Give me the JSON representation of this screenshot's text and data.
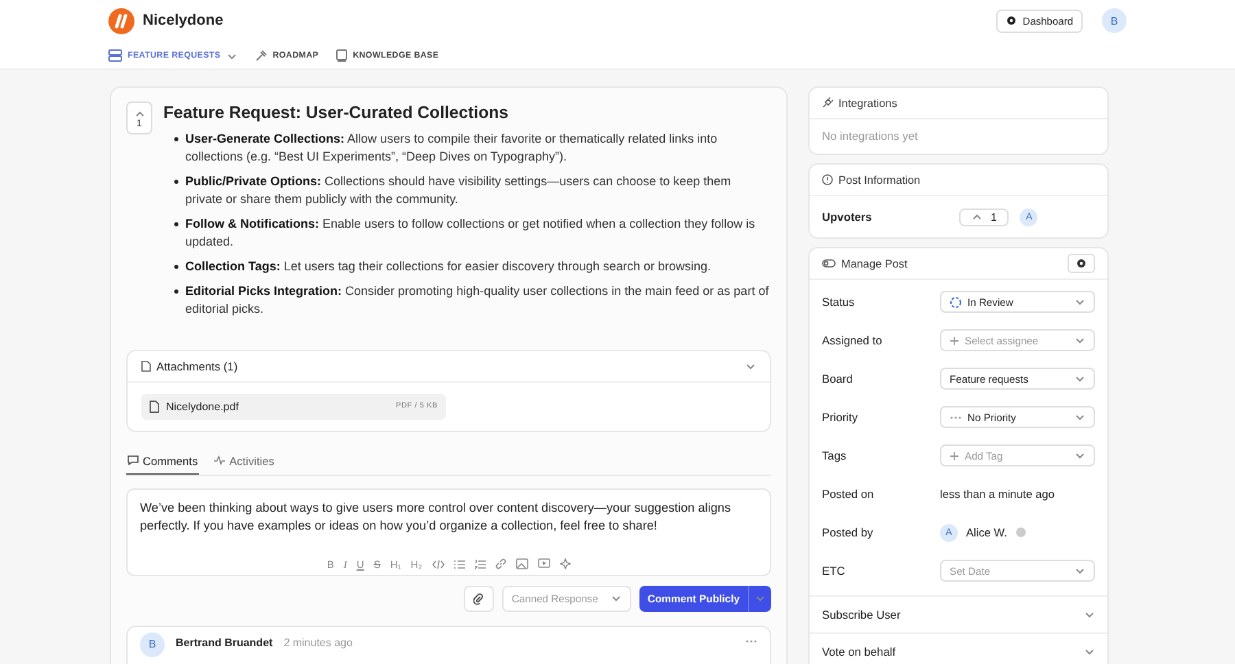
{
  "app": {
    "name": "Nicelydone",
    "dashboard_button": "Dashboard",
    "user_initial": "B"
  },
  "nav": [
    {
      "label": "FEATURE REQUESTS",
      "selected": true,
      "kind": "boards"
    },
    {
      "label": "ROADMAP",
      "selected": false,
      "kind": "roadmap"
    },
    {
      "label": "KNOWLEDGE BASE",
      "selected": false,
      "kind": "book"
    }
  ],
  "post": {
    "votes": "1",
    "title": "Feature Request: User-Curated Collections",
    "bullets": [
      "**User-Generate Collections:** Allow users to compile their favorite or thematically related links into collections (e.g. “Best UI Experiments”, “Deep Dives on Typography”).",
      "**Public/Private Options:** Collections should have visibility settings—users can choose to keep them private or share them publicly with the community.",
      "**Follow & Notifications:** Enable users to follow collections or get notified when a collection they follow is updated.",
      "**Collection Tags:** Let users tag their collections for easier discovery through search or browsing.",
      "**Editorial Picks Integration:** Consider promoting high-quality user collections in the main feed or as part of editorial picks."
    ]
  },
  "attachments": {
    "title": "Attachments (1)",
    "files": [
      {
        "name": "Nicelydone.pdf",
        "meta": "PDF / 5 KB"
      }
    ]
  },
  "tabs": [
    {
      "label": "Comments",
      "selected": true,
      "kind": "comments"
    },
    {
      "label": "Activities",
      "selected": false,
      "kind": "activity"
    }
  ],
  "editor": {
    "value": "We’ve been thinking about ways to give users more control over content discovery—your suggestion aligns perfectly. If you have examples or ideas on how you’d organize a collection, feel free to share!",
    "format_buttons": [
      "B",
      "I",
      "U",
      "S",
      "H₁",
      "H₂"
    ],
    "canned_response": {
      "placeholder": "Canned Response"
    },
    "submit": "Comment Publicly"
  },
  "comments": [
    {
      "initial": "B",
      "author": "Bertrand Bruandet",
      "time": "2 minutes ago"
    }
  ],
  "integrations": {
    "title": "Integrations",
    "empty": "No integrations yet"
  },
  "post_information": {
    "title": "Post Information",
    "upvoters_label": "Upvoters",
    "upvote_count": "1",
    "upvoter_initials": [
      "A"
    ]
  },
  "manage_post": {
    "title": "Manage Post",
    "fields": [
      {
        "label": "Status",
        "kind": "status",
        "value": "In Review"
      },
      {
        "label": "Assigned to",
        "kind": "add",
        "placeholder": "Select assignee"
      },
      {
        "label": "Board",
        "kind": "select",
        "value": "Feature requests"
      },
      {
        "label": "Priority",
        "kind": "priority",
        "value": "No Priority"
      },
      {
        "label": "Tags",
        "kind": "add",
        "placeholder": "Add Tag"
      },
      {
        "label": "Posted on",
        "kind": "text",
        "value": "less than a minute ago"
      },
      {
        "label": "Posted by",
        "kind": "user",
        "initial": "A",
        "value": "Alice W."
      },
      {
        "label": "ETC",
        "kind": "select",
        "placeholder": "Set Date"
      }
    ],
    "sections": [
      {
        "label": "Subscribe User",
        "expanded": false
      },
      {
        "label": "Vote on behalf",
        "expanded": false
      }
    ]
  }
}
